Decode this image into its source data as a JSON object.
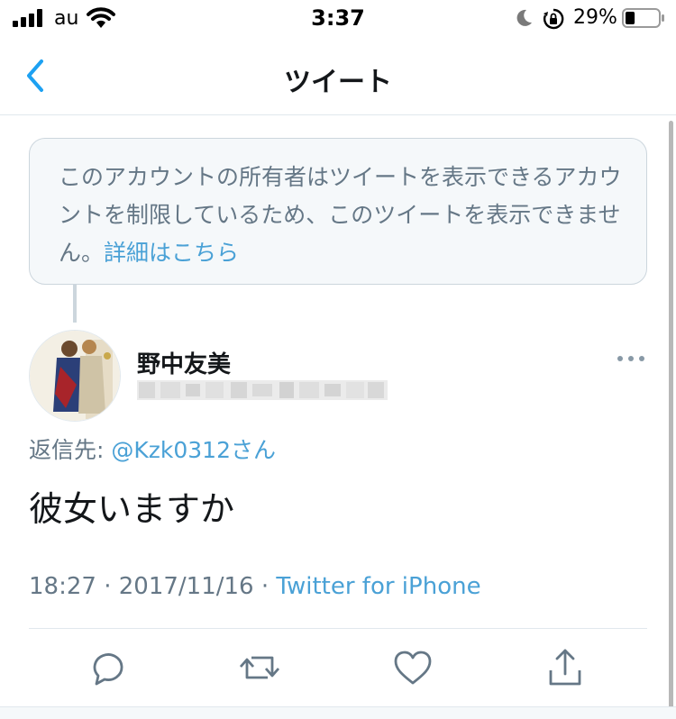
{
  "status_bar": {
    "carrier": "au",
    "time": "3:37",
    "battery_percent": "29%",
    "battery_level": 0.29,
    "icons": [
      "signal-icon",
      "wifi-icon",
      "moon-icon",
      "rotation-lock-icon",
      "battery-icon"
    ]
  },
  "nav": {
    "title": "ツイート",
    "back_icon": "chevron-left-icon"
  },
  "notice": {
    "text": "このアカウントの所有者はツイートを表示できるアカウントを制限しているため、このツイートを表示できません。",
    "link": "詳細はこちら"
  },
  "tweet": {
    "display_name": "野中友美",
    "reply_label": "返信先: ",
    "reply_handle": "@Kzk0312さん",
    "text": "彼女いますか",
    "time": "18:27",
    "separator": " · ",
    "date": "2017/11/16",
    "source": "Twitter for iPhone"
  },
  "actions": [
    "reply-icon",
    "retweet-icon",
    "like-icon",
    "share-icon"
  ],
  "colors": {
    "accent": "#1da1f2",
    "link": "#4aa1d6",
    "secondary_text": "#657786",
    "border": "#ccd6dd"
  }
}
